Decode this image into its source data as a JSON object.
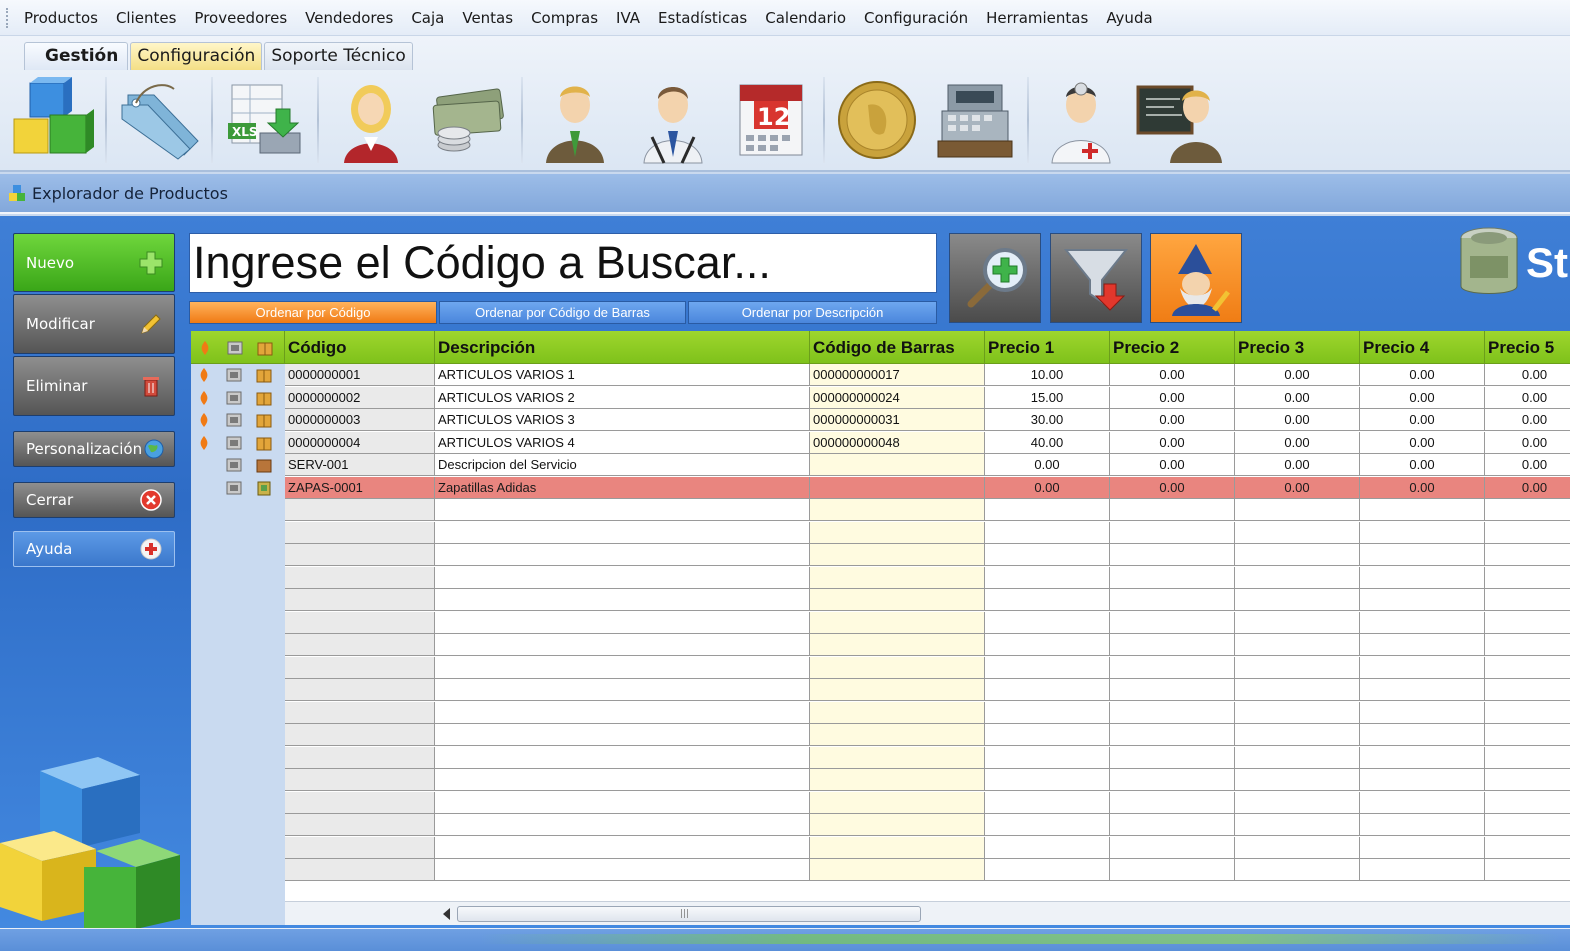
{
  "menu": [
    "Productos",
    "Clientes",
    "Proveedores",
    "Vendedores",
    "Caja",
    "Ventas",
    "Compras",
    "IVA",
    "Estadísticas",
    "Calendario",
    "Configuración",
    "Herramientas",
    "Ayuda"
  ],
  "ribbon": {
    "tabs": [
      {
        "label": "Gestión"
      },
      {
        "label": "Configuración"
      },
      {
        "label": "Soporte Técnico"
      }
    ],
    "tools": [
      {
        "icon": "product-cubes-icon"
      },
      {
        "icon": "price-tags-icon"
      },
      {
        "icon": "excel-import-icon",
        "text": "XLS"
      },
      {
        "icon": "user-woman-icon"
      },
      {
        "icon": "money-coins-icon"
      },
      {
        "icon": "businessman-icon"
      },
      {
        "icon": "vendor-man-icon"
      },
      {
        "icon": "calendar-icon",
        "text": "12"
      },
      {
        "icon": "gold-coin-icon"
      },
      {
        "icon": "cash-register-icon"
      },
      {
        "icon": "doctor-icon"
      },
      {
        "icon": "teacher-blackboard-icon"
      }
    ]
  },
  "explorer": {
    "title": "Explorador de Productos"
  },
  "sidebar": {
    "nuevo": "Nuevo",
    "modificar": "Modificar",
    "eliminar": "Eliminar",
    "personalizacion": "Personalización",
    "cerrar": "Cerrar",
    "ayuda": "Ayuda"
  },
  "search": {
    "placeholder": "Ingrese el Código a Buscar..."
  },
  "sort": {
    "codigo": "Ordenar por Código",
    "barras": "Ordenar por Código de Barras",
    "descripcion": "Ordenar por Descripción"
  },
  "brand": {
    "text": "St"
  },
  "colors": {
    "accent_green": "#8ccb22",
    "selected_row": "#e9857f",
    "sort_active": "#f28a1e"
  },
  "grid": {
    "columns": [
      "Código",
      "Descripción",
      "Código de Barras",
      "Precio 1",
      "Precio 2",
      "Precio 3",
      "Precio 4",
      "Precio 5"
    ],
    "rows": [
      {
        "codigo": "0000000001",
        "descripcion": "ARTICULOS VARIOS 1",
        "barras": "000000000017",
        "p1": "10.00",
        "p2": "0.00",
        "p3": "0.00",
        "p4": "0.00",
        "p5": "0.00",
        "type": "product",
        "flame": true
      },
      {
        "codigo": "0000000002",
        "descripcion": "ARTICULOS VARIOS 2",
        "barras": "000000000024",
        "p1": "15.00",
        "p2": "0.00",
        "p3": "0.00",
        "p4": "0.00",
        "p5": "0.00",
        "type": "product",
        "flame": true
      },
      {
        "codigo": "0000000003",
        "descripcion": "ARTICULOS VARIOS 3",
        "barras": "000000000031",
        "p1": "30.00",
        "p2": "0.00",
        "p3": "0.00",
        "p4": "0.00",
        "p5": "0.00",
        "type": "product",
        "flame": true
      },
      {
        "codigo": "0000000004",
        "descripcion": "ARTICULOS VARIOS 4",
        "barras": "000000000048",
        "p1": "40.00",
        "p2": "0.00",
        "p3": "0.00",
        "p4": "0.00",
        "p5": "0.00",
        "type": "product",
        "flame": true
      },
      {
        "codigo": "SERV-001",
        "descripcion": "Descripcion del Servicio",
        "barras": "",
        "p1": "0.00",
        "p2": "0.00",
        "p3": "0.00",
        "p4": "0.00",
        "p5": "0.00",
        "type": "service",
        "flame": false
      },
      {
        "codigo": "ZAPAS-0001",
        "descripcion": "Zapatillas Adidas",
        "barras": "",
        "p1": "0.00",
        "p2": "0.00",
        "p3": "0.00",
        "p4": "0.00",
        "p5": "0.00",
        "type": "item",
        "flame": false,
        "selected": true
      }
    ]
  }
}
